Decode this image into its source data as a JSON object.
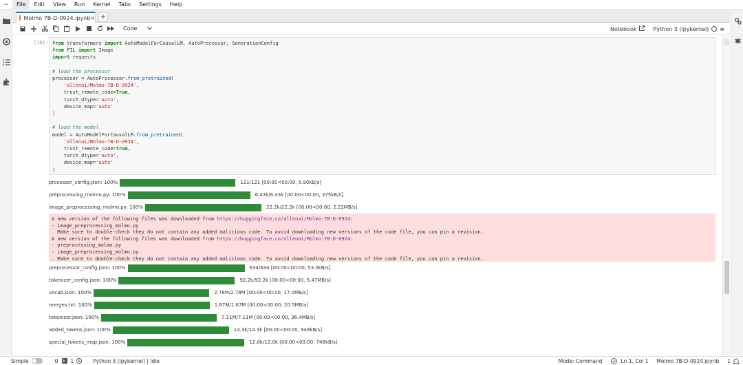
{
  "menubar": {
    "logo": "~",
    "items": [
      "File",
      "Edit",
      "View",
      "Run",
      "Kernel",
      "Tabs",
      "Settings",
      "Help"
    ],
    "active_index": 0
  },
  "tab": {
    "title": "Molmo 7B-D-0924.ipynb",
    "close": "×",
    "new_tab": "+"
  },
  "toolbar": {
    "cell_type": "Code",
    "notebook_label": "Notebook",
    "kernel_label": "Python 3 (ipykernel)",
    "menu_glyph": "≡"
  },
  "cell": {
    "prompt": "[10]:"
  },
  "code_lines": [
    [
      [
        "kw",
        "from"
      ],
      [
        "",
        "transformers "
      ],
      [
        "kw",
        "import"
      ],
      [
        "",
        "AutoModelForCausalLM, AutoProcessor, GenerationConfig"
      ]
    ],
    [
      [
        "kw",
        "from"
      ],
      [
        "",
        "PIL "
      ],
      [
        "kw",
        "import"
      ],
      [
        "",
        "Image"
      ]
    ],
    [
      [
        "kw",
        "import"
      ],
      [
        "",
        "requests"
      ]
    ],
    [],
    [
      [
        "cm",
        "# load the processor"
      ]
    ],
    [
      [
        "",
        "processor = AutoProcessor."
      ],
      [
        "fn",
        "from_pretrained"
      ],
      [
        "",
        "("
      ]
    ],
    [
      [
        "",
        "    "
      ],
      [
        "str",
        "'allenai/Molmo-7B-D-0924'"
      ],
      [
        "",
        ","
      ]
    ],
    [
      [
        "",
        "    trust_remote_code="
      ],
      [
        "kw",
        "True"
      ],
      [
        "",
        ","
      ]
    ],
    [
      [
        "",
        "    torch_dtype="
      ],
      [
        "str",
        "'auto'"
      ],
      [
        "",
        ","
      ]
    ],
    [
      [
        "",
        "    device_map="
      ],
      [
        "str",
        "'auto'"
      ]
    ],
    [
      [
        "",
        ")"
      ]
    ],
    [],
    [
      [
        "cm",
        "# load the model"
      ]
    ],
    [
      [
        "",
        "model = AutoModelForCausalLM."
      ],
      [
        "fn",
        "from_pretrained"
      ],
      [
        "",
        "("
      ]
    ],
    [
      [
        "",
        "    "
      ],
      [
        "str",
        "'allenai/Molmo-7B-D-0924'"
      ],
      [
        "",
        ","
      ]
    ],
    [
      [
        "",
        "    trust_remote_code="
      ],
      [
        "kw",
        "True"
      ],
      [
        "",
        ","
      ]
    ],
    [
      [
        "",
        "    torch_dtype="
      ],
      [
        "str",
        "'auto'"
      ],
      [
        "",
        ","
      ]
    ],
    [
      [
        "",
        "    device_map="
      ],
      [
        "str",
        "'auto'"
      ]
    ],
    [
      [
        "",
        ")"
      ]
    ]
  ],
  "progress_top": [
    {
      "label": "processor_config.json:",
      "pct": "100%",
      "stats": "121/121",
      "time": "[00:00<00:00,  5.90kB/s]"
    },
    {
      "label": "preprocessing_molmo.py:",
      "pct": "100%",
      "stats": "6.43k/6.43k",
      "time": "[00:00<00:00,  375kB/s]"
    },
    {
      "label": "image_preprocessing_molmo.py:",
      "pct": "100%",
      "stats": "22.2k/22.2k",
      "time": "[00:00<00:00,  2.22MB/s]"
    }
  ],
  "stderr_lines": [
    [
      [
        "",
        "A new version of the following files was downloaded from "
      ],
      [
        "url",
        "https://huggingface.co/allenai/Molmo-7B-D-0924"
      ],
      [
        "",
        ":"
      ]
    ],
    [
      [
        "",
        "- image_preprocessing_molmo.py"
      ]
    ],
    [
      [
        "",
        ". Make sure to double-check they do not contain any added malicious code. To avoid downloading new versions of the code file, you can pin a revision."
      ]
    ],
    [
      [
        "",
        "A new version of the following files was downloaded from "
      ],
      [
        "url",
        "https://huggingface.co/allenai/Molmo-7B-D-0924"
      ],
      [
        "",
        ":"
      ]
    ],
    [
      [
        "",
        "- preprocessing_molmo.py"
      ]
    ],
    [
      [
        "",
        "- image_preprocessing_molmo.py"
      ]
    ],
    [
      [
        "",
        ". Make sure to double-check they do not contain any added malicious code. To avoid downloading new versions of the code file, you can pin a revision."
      ]
    ]
  ],
  "progress_bottom": [
    {
      "label": "preprocessor_config.json:",
      "pct": "100%",
      "stats": "634/634",
      "time": "[00:00<00:00,  53.0kB/s]"
    },
    {
      "label": "tokenizer_config.json:",
      "pct": "100%",
      "stats": "92.2k/92.2k",
      "time": "[00:00<00:00,  5.47MB/s]"
    },
    {
      "label": "vocab.json:",
      "pct": "100%",
      "stats": "2.78M/2.78M",
      "time": "[00:00<00:00,  17.0MB/s]"
    },
    {
      "label": "merges.txt:",
      "pct": "100%",
      "stats": "1.67M/1.67M",
      "time": "[00:00<00:00,  20.5MB/s]"
    },
    {
      "label": "tokenizer.json:",
      "pct": "100%",
      "stats": "7.11M/7.11M",
      "time": "[00:00<00:00,  36.4MB/s]"
    },
    {
      "label": "added_tokens.json:",
      "pct": "100%",
      "stats": "14.3k/14.3k",
      "time": "[00:00<00:00,  948kB/s]"
    },
    {
      "label": "special_tokens_map.json:",
      "pct": "100%",
      "stats": "12.0k/12.0k",
      "time": "[00:00<00:00,  748kB/s]"
    }
  ],
  "statusbar": {
    "mode_label": "Simple",
    "count_a": "0",
    "count_b": "1",
    "kernel_status": "Python 3 (ipykernel) | Idle",
    "mode": "Mode: Command",
    "position": "Ln 1, Col 1",
    "filename": "Molmo 7B-D-0924.ipynb",
    "notifications": "1"
  }
}
